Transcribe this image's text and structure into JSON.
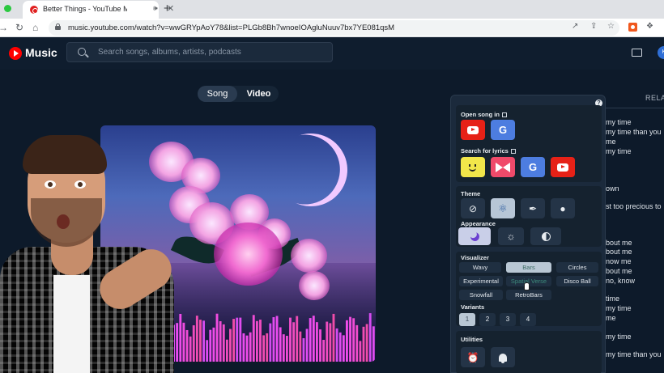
{
  "browser": {
    "tab_title": "Better Things - YouTube M",
    "url": "music.youtube.com/watch?v=wwGRYpAoY78&list=PLGb8Bh7wnoeIOAgluNuuv7bx7YE081qsM"
  },
  "header": {
    "brand": "Music",
    "search_placeholder": "Search songs, albums, artists, podcasts",
    "avatar_letter": "K"
  },
  "toggle": {
    "song": "Song",
    "video": "Video"
  },
  "right_panel": {
    "tab_label": "RELA",
    "lyrics": [
      "my time",
      "my time than you",
      "me",
      "my time",
      "own",
      "st too precious to",
      "bout me",
      "bout me",
      "now me",
      "bout me",
      "no, know",
      "time",
      "my time",
      "me",
      "my time",
      "my time than you"
    ]
  },
  "extension": {
    "open_song_in": "Open song in",
    "search_for_lyrics": "Search for lyrics",
    "theme": "Theme",
    "appearance": "Appearance",
    "visualizer": "Visualizer",
    "visualizer_options": [
      "Wavy",
      "Bars",
      "Circles",
      "Experimental",
      "Spatial Verse",
      "Disco Ball",
      "Snowfall",
      "RetroBars"
    ],
    "variants": "Variants",
    "variant_options": [
      "1",
      "2",
      "3",
      "4"
    ],
    "utilities": "Utilities",
    "g_label": "G",
    "help": "?"
  },
  "colors": {
    "accent_youtube": "#e62117",
    "google_blue": "#4d7de0",
    "active_button": "#b7c6d6",
    "panel_bg": "#1b2a3c"
  },
  "icons": [
    "youtube-icon",
    "google-icon",
    "genius-smile-icon",
    "musixmatch-icon",
    "eye-off-icon",
    "atom-icon",
    "eyedropper-icon",
    "apple-icon",
    "moon-icon",
    "sun-icon",
    "contrast-icon",
    "alarm-icon",
    "bell-icon"
  ]
}
